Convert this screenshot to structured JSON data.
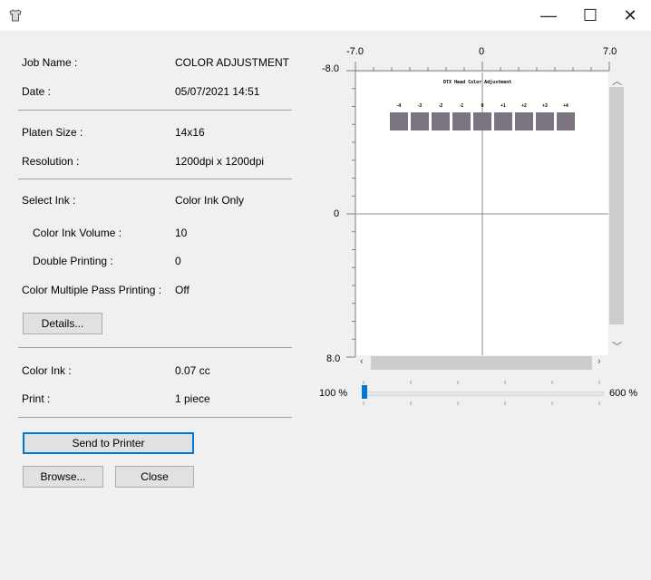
{
  "window": {
    "icon": "tshirt-icon",
    "minimize_glyph": "—",
    "maximize_glyph": "☐",
    "close_glyph": "✕"
  },
  "job": {
    "job_name_label": "Job Name :",
    "job_name_value": "COLOR ADJUSTMENT",
    "date_label": "Date :",
    "date_value": "05/07/2021 14:51",
    "platen_label": "Platen Size :",
    "platen_value": "14x16",
    "resolution_label": "Resolution :",
    "resolution_value": "1200dpi x 1200dpi",
    "select_ink_label": "Select Ink :",
    "select_ink_value": "Color Ink Only",
    "color_ink_volume_label": "Color Ink Volume :",
    "color_ink_volume_value": "10",
    "double_printing_label": "Double Printing :",
    "double_printing_value": "0",
    "multi_pass_label": "Color Multiple Pass Printing :",
    "multi_pass_value": "Off",
    "details_button": "Details...",
    "color_ink_label": "Color Ink :",
    "color_ink_value": "0.07 cc",
    "print_label": "Print :",
    "print_value": "1 piece"
  },
  "buttons": {
    "send": "Send to Printer",
    "browse": "Browse...",
    "close": "Close"
  },
  "preview": {
    "x_min": "-7.0",
    "x_mid": "0",
    "x_max": "7.0",
    "y_min": "-8.0",
    "y_mid": "0",
    "y_max": "8.0",
    "pattern_title": "DTX Head Color Adjustment",
    "pattern_labels": [
      "-4",
      "-3",
      "-2",
      "-1",
      "0",
      "+1",
      "+2",
      "+3",
      "+4"
    ],
    "swatch_color": "#7b7380"
  },
  "zoom": {
    "min_label": "100 %",
    "max_label": "600 %",
    "level_percent": 100
  }
}
